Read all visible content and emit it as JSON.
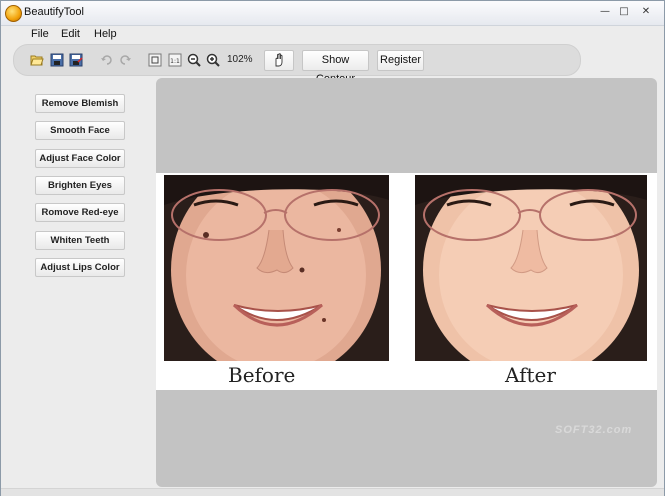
{
  "window": {
    "title": "BeautifyTool"
  },
  "menu": {
    "file": "File",
    "edit": "Edit",
    "help": "Help"
  },
  "toolbar": {
    "zoom": "102%",
    "show_contour": "Show Contour",
    "register": "Register",
    "icons": [
      "open-icon",
      "save-icon",
      "save-as-icon",
      "undo-icon",
      "redo-icon",
      "fit-window-icon",
      "actual-size-icon",
      "zoom-out-icon",
      "zoom-in-icon",
      "hand-pan-icon"
    ]
  },
  "sidebar": {
    "buttons": [
      "Remove Blemish",
      "Smooth Face",
      "Adjust Face Color",
      "Brighten Eyes",
      "Romove Red-eye",
      "Whiten Teeth",
      "Adjust Lips Color"
    ]
  },
  "canvas": {
    "before_label": "Before",
    "after_label": "After"
  },
  "watermark": "SOFT32.com",
  "colors": {
    "canvas_bg": "#c3c3c3",
    "window_bg": "#ececec",
    "app_icon": "#f2a20a"
  }
}
